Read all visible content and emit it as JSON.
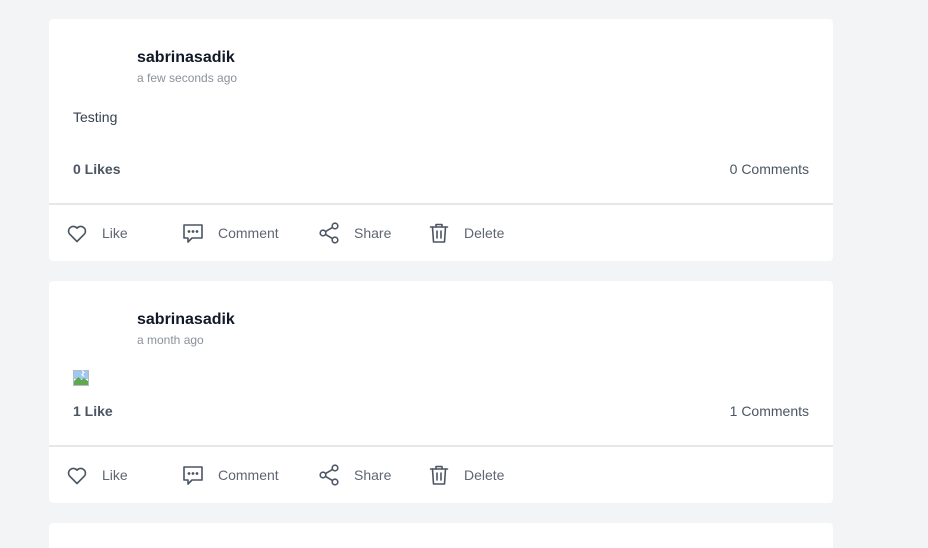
{
  "posts": [
    {
      "author": "sabrinasadik",
      "time": "a few seconds ago",
      "text": "Testing",
      "likes": "0 Likes",
      "comments": "0 Comments"
    },
    {
      "author": "sabrinasadik",
      "time": "a month ago",
      "text": "",
      "likes": "1 Like",
      "comments": "1 Comments"
    }
  ],
  "actions": {
    "like": "Like",
    "comment": "Comment",
    "share": "Share",
    "delete": "Delete"
  },
  "icons": {
    "like": "heart-icon",
    "comment": "comment-icon",
    "share": "share-icon",
    "delete": "trash-icon",
    "image": "broken-image-icon"
  },
  "colors": {
    "page_background": "#f3f4f6",
    "card_background": "#ffffff",
    "author_text": "#111827",
    "muted_text": "#8b919b",
    "action_text": "#5f6671",
    "divider": "#e5e7eb"
  }
}
